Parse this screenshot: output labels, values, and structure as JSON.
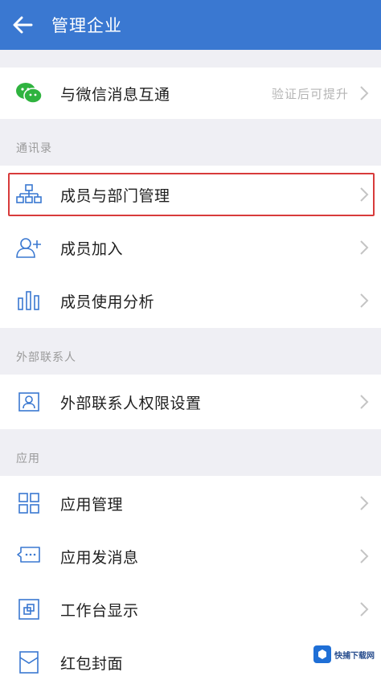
{
  "header": {
    "title": "管理企业"
  },
  "wechat_row": {
    "label": "与微信消息互通",
    "right_text": "验证后可提升"
  },
  "sections": {
    "contacts": "通讯录",
    "external": "外部联系人",
    "apps": "应用"
  },
  "contacts_rows": {
    "org": "成员与部门管理",
    "join": "成员加入",
    "usage": "成员使用分析"
  },
  "external_rows": {
    "permissions": "外部联系人权限设置"
  },
  "app_rows": {
    "manage": "应用管理",
    "message": "应用发消息",
    "workbench": "工作台显示",
    "redpacket": "红包封面"
  },
  "watermark": {
    "text": "快捕下载网"
  },
  "colors": {
    "header": "#3a78d1",
    "highlight": "#d83b3b",
    "icon": "#3a78d1",
    "wechat": "#2fb33f"
  }
}
